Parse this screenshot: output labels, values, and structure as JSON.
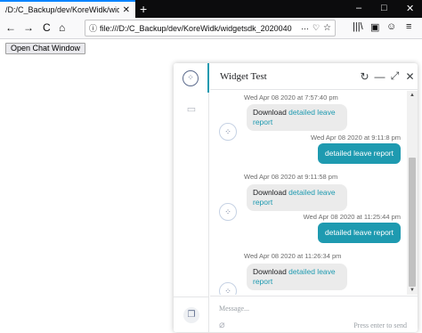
{
  "browser": {
    "tab_title": "/D:/C_Backup/dev/KoreWidk/widg",
    "tab_close": "✕",
    "new_tab": "+",
    "url": "file:///D:/C_Backup/dev/KoreWidk/widgetsdk_2020040",
    "window_controls": [
      "–",
      "□",
      "✕"
    ],
    "nav": {
      "back": "←",
      "forward": "→",
      "reload": "C",
      "home": "⌂"
    },
    "toolbar_icons": [
      "|||\\",
      "▣",
      "☺",
      "≡"
    ],
    "url_icons": [
      "···",
      "♡",
      "☆"
    ]
  },
  "page": {
    "open_chat_label": "Open Chat Window"
  },
  "widget": {
    "title": "Widget Test",
    "header_icons": {
      "reload": "↻",
      "minimize": "—",
      "expand": "⤢",
      "close": "✕"
    },
    "messages": [
      {
        "type": "ts",
        "text": "Wed Apr 08 2020 at 7:57:40 pm",
        "align": "left"
      },
      {
        "type": "bot",
        "prefix": "Download ",
        "link": "detailed leave report"
      },
      {
        "type": "ts",
        "text": "Wed Apr 08 2020 at 9:11:8 pm",
        "align": "right"
      },
      {
        "type": "user",
        "text": "detailed leave report"
      },
      {
        "type": "ts",
        "text": "Wed Apr 08 2020 at 9:11:58 pm",
        "align": "left"
      },
      {
        "type": "bot",
        "prefix": "Download ",
        "link": "detailed leave report"
      },
      {
        "type": "ts",
        "text": "Wed Apr 08 2020 at 11:25:44 pm",
        "align": "right"
      },
      {
        "type": "user",
        "text": "detailed leave report"
      },
      {
        "type": "ts",
        "text": "Wed Apr 08 2020 at 11:26:34 pm",
        "align": "left"
      },
      {
        "type": "bot",
        "prefix": "Download ",
        "link": "detailed leave report"
      }
    ],
    "composer": {
      "placeholder": "Message...",
      "hint": "Press enter to send"
    }
  },
  "icons": {
    "bot": "bot-icon",
    "gallery": "gallery-icon",
    "square": "square-icon",
    "attach": "paperclip-icon"
  },
  "colors": {
    "accent": "#1e9ab0",
    "tab_border": "#0a84ff",
    "bubble_bot": "#ebebeb"
  }
}
